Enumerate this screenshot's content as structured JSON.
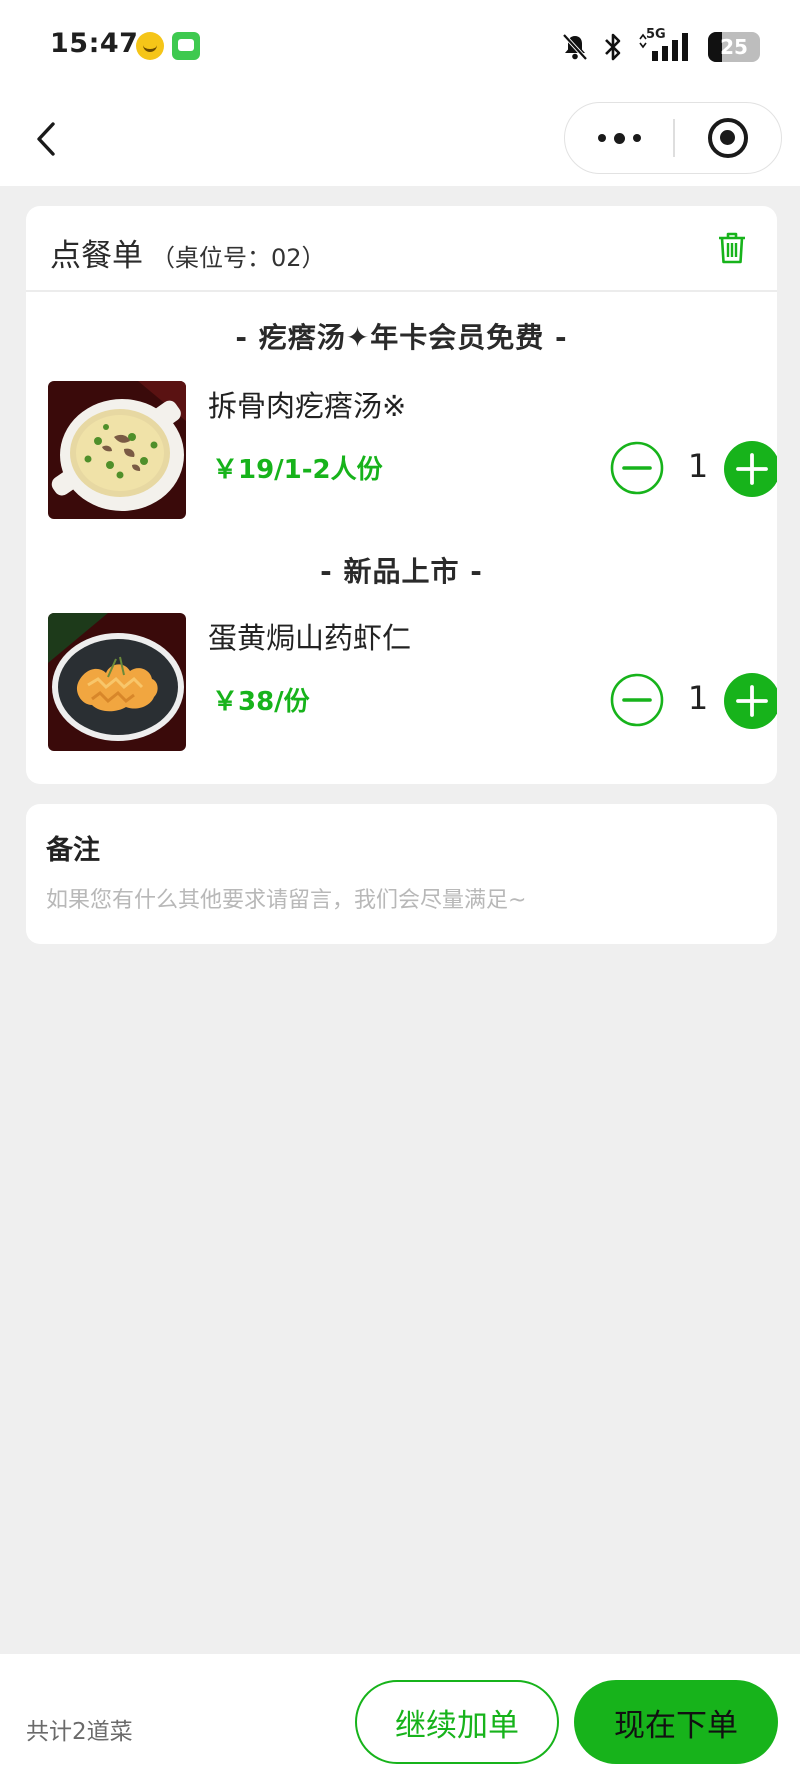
{
  "status_bar": {
    "time": "15:47",
    "network": "5G",
    "battery": "25"
  },
  "nav": {
    "back_icon": "chevron-left-icon",
    "more_icon": "more-dots-icon",
    "close_icon": "target-icon"
  },
  "order": {
    "title": "点餐单",
    "table_number": "（桌位号：02）",
    "delete_icon": "trash-icon",
    "sections": [
      {
        "title": "- 疙瘩汤✦年卡会员免费 -",
        "dishes": [
          {
            "name": "拆骨肉疙瘩汤※",
            "price": "￥19/1-2人份",
            "quantity": "1"
          }
        ]
      },
      {
        "title": "- 新品上市 -",
        "dishes": [
          {
            "name": "蛋黄焗山药虾仁",
            "price": "￥38/份",
            "quantity": "1"
          }
        ]
      }
    ]
  },
  "remark": {
    "title": "备注",
    "placeholder": "如果您有什么其他要求请留言，我们会尽量满足~",
    "value": ""
  },
  "bottom_bar": {
    "total": "共计2道菜",
    "continue_label": "继续加单",
    "submit_label": "现在下单"
  },
  "colors": {
    "accent": "#17b31b",
    "background": "#efefef",
    "card": "#ffffff"
  }
}
